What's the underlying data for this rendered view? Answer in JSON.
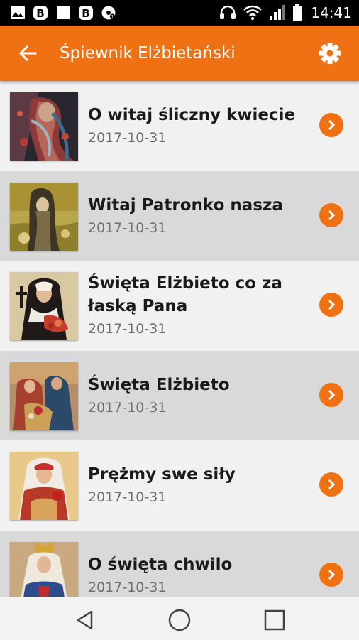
{
  "status_bar": {
    "time": "14:41",
    "left_icons": [
      "image-icon",
      "b-app-icon",
      "square-icon",
      "b-app-icon",
      "soccer-ball-icon"
    ],
    "right_icons": [
      "headset-icon",
      "wifi-icon",
      "signal-icon",
      "battery-icon"
    ]
  },
  "app_bar": {
    "title": "Śpiewnik Elżbietański",
    "back_icon": "arrow-left-icon",
    "settings_icon": "gear-icon",
    "color": "#f07014"
  },
  "songs": [
    {
      "title": "O witaj śliczny kwiecie",
      "date": "2017-10-31"
    },
    {
      "title": "Witaj Patronko nasza",
      "date": "2017-10-31"
    },
    {
      "title": "Święta Elżbieto co za łaską Pana",
      "date": "2017-10-31"
    },
    {
      "title": "Święta Elżbieto",
      "date": "2017-10-31"
    },
    {
      "title": "Prężmy swe siły",
      "date": "2017-10-31"
    },
    {
      "title": "O święta chwilo",
      "date": "2017-10-31"
    }
  ],
  "nav_bar": {
    "back_icon": "triangle-back-icon",
    "home_icon": "circle-home-icon",
    "recents_icon": "square-recents-icon"
  }
}
